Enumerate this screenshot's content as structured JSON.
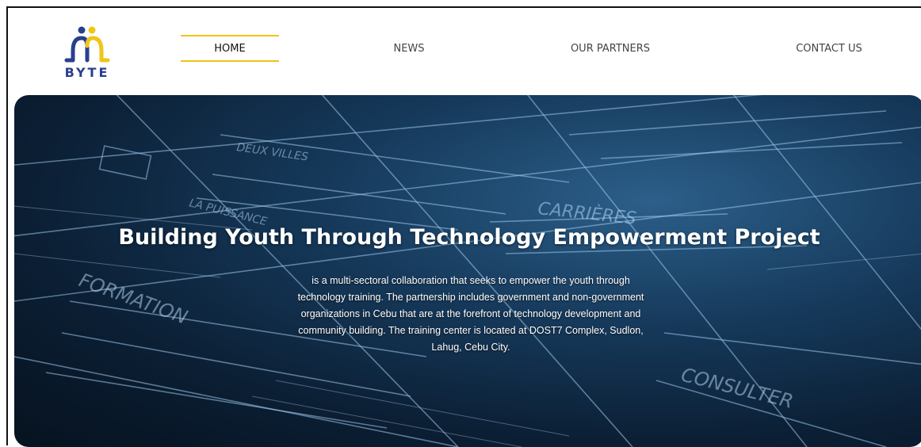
{
  "brand": {
    "name": "BYTE",
    "colors": {
      "yellow": "#f0c419",
      "blue": "#2a3f8f"
    }
  },
  "nav": {
    "items": [
      {
        "label": "HOME",
        "active": true
      },
      {
        "label": "NEWS",
        "active": false
      },
      {
        "label": "OUR PARTNERS",
        "active": false
      },
      {
        "label": "CONTACT US",
        "active": false
      }
    ]
  },
  "hero": {
    "title": "Building Youth Through Technology Empowerment Project",
    "description": "is a multi-sectoral collaboration that seeks to empower the youth through technology training. The partnership includes government and non-government organizations in Cebu that are at the forefront of technology development and community building. The training center is located at DOST7 Complex, Sudlon, Lahug, Cebu City.",
    "sketch_words": [
      "DEUX VILLES",
      "LA PUISSANCE",
      "FORMATION",
      "CARRIÈRES",
      "CONSULTER"
    ]
  }
}
